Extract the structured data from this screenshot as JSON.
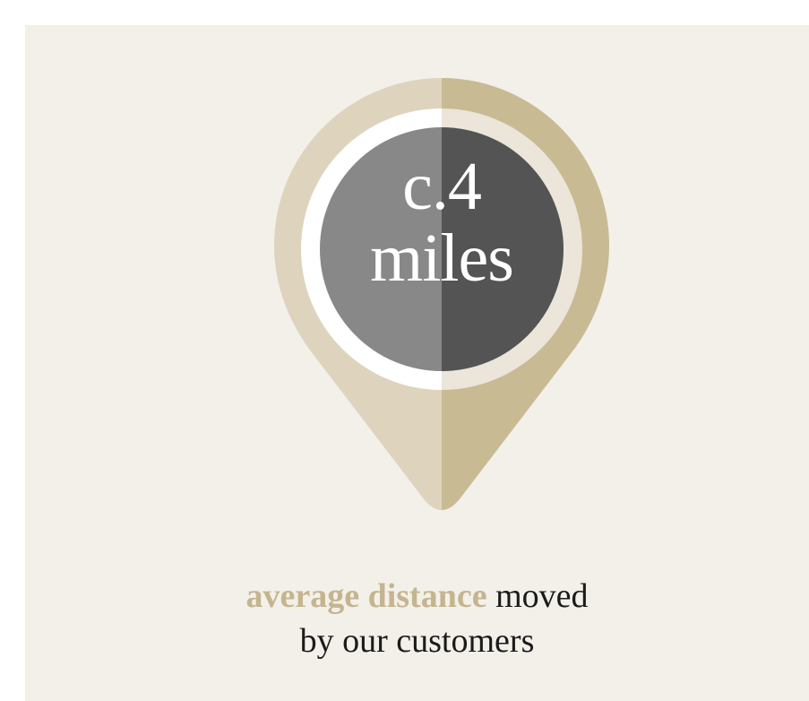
{
  "badge": {
    "value": "c.4",
    "unit": "miles"
  },
  "caption": {
    "highlight": "average distance",
    "rest_line1": "moved",
    "line2": "by our customers"
  },
  "colors": {
    "background": "#f3f0ea",
    "pin_light": "#ded4bd",
    "pin_dark": "#c8ba93",
    "ring_light": "#ffffff",
    "ring_dark": "#ebe5da",
    "disc_light": "#888888",
    "disc_dark": "#545454",
    "accent_text": "#c5b58f"
  },
  "icons": {
    "pin": "map-pin-icon"
  }
}
